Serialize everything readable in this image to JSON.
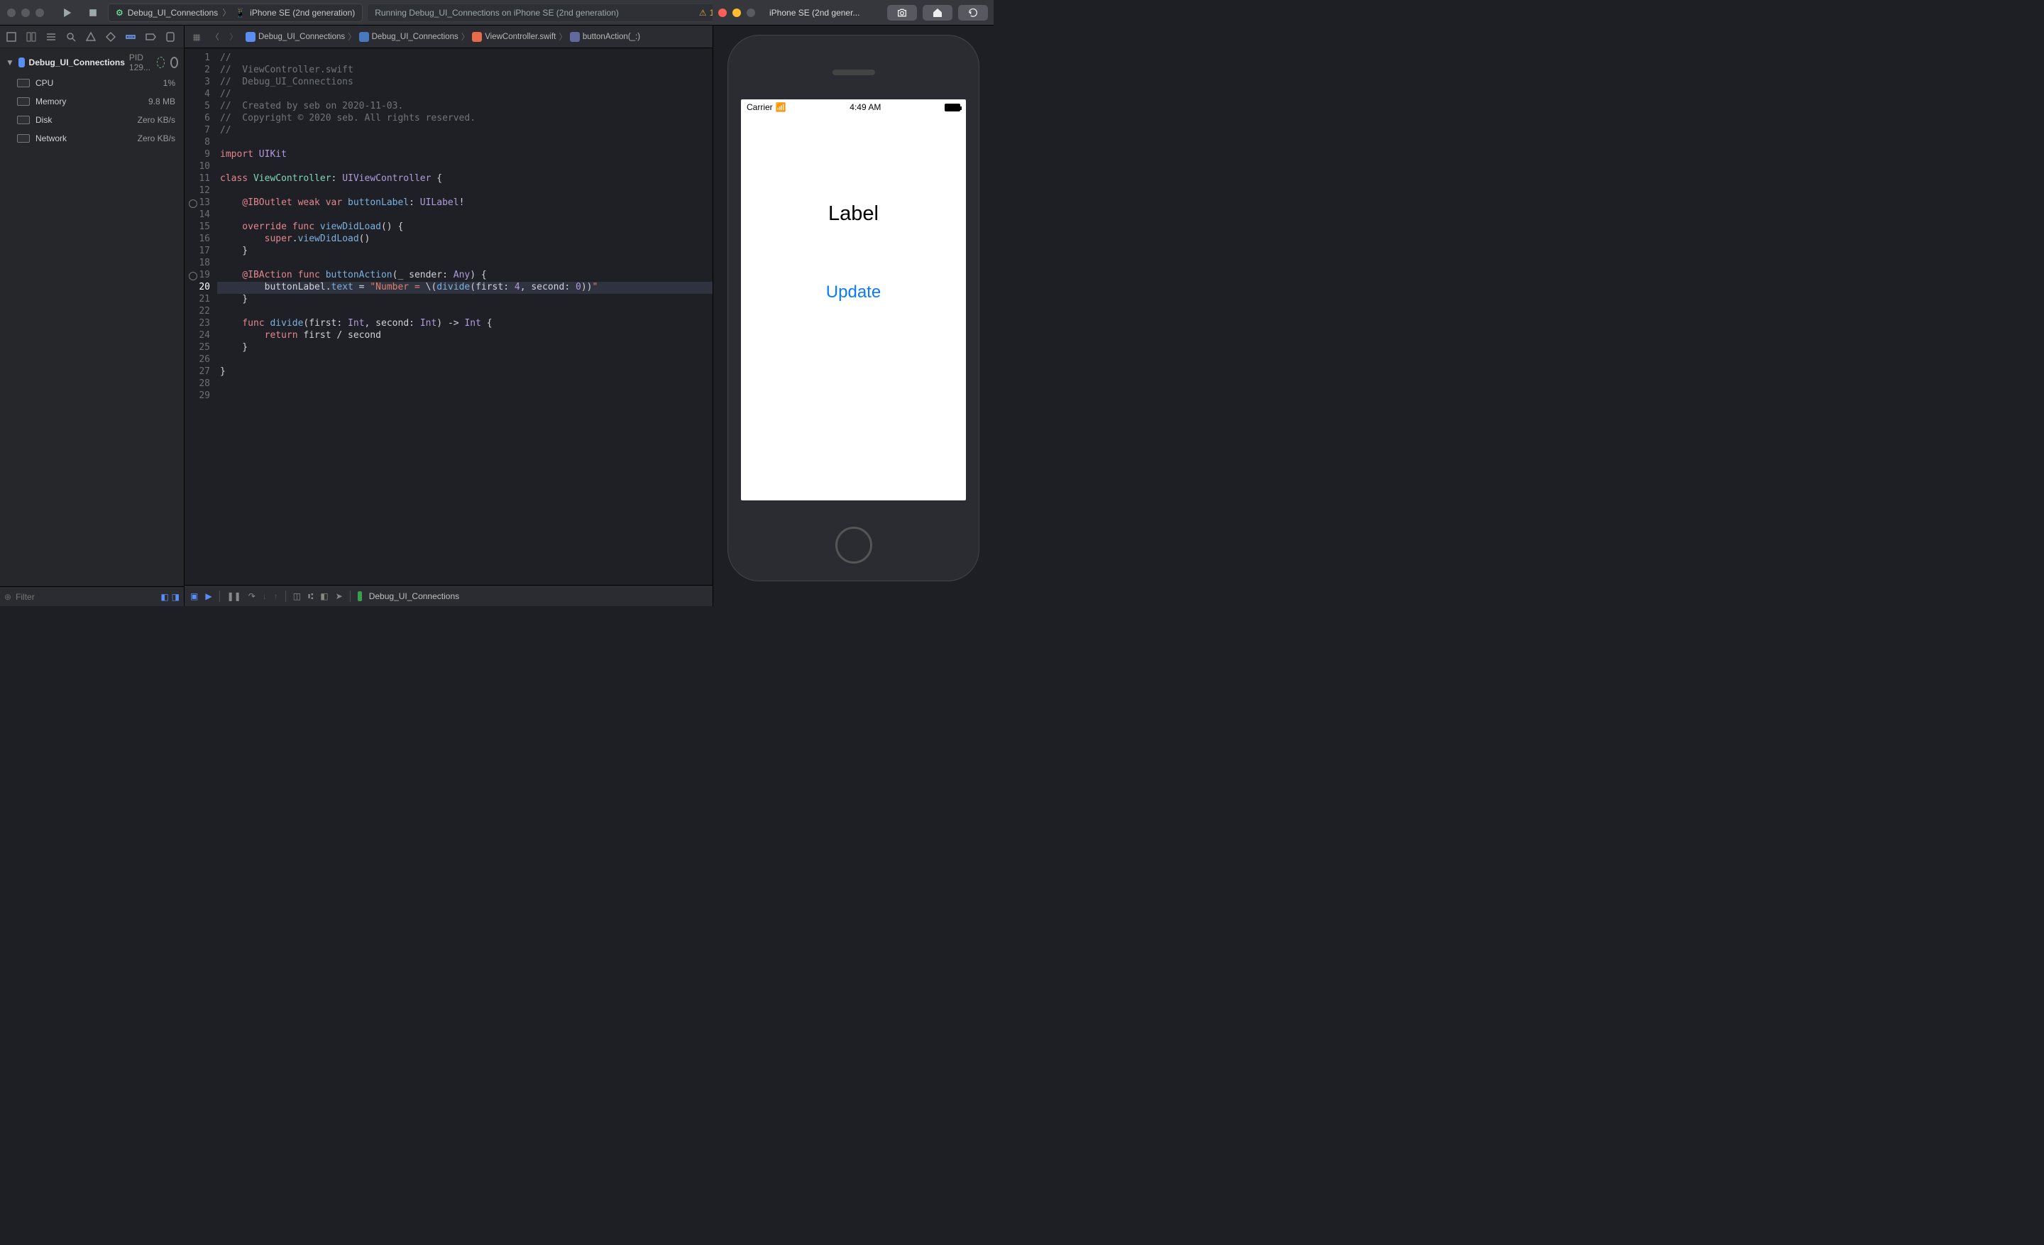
{
  "titlebar": {
    "scheme": "Debug_UI_Connections",
    "device": "iPhone SE (2nd generation)",
    "status": "Running Debug_UI_Connections on iPhone SE (2nd generation)",
    "warn_count": "1"
  },
  "navigator": {
    "root_name": "Debug_UI_Connections",
    "root_pid": "PID 129...",
    "resources": [
      {
        "name": "CPU",
        "val": "1%"
      },
      {
        "name": "Memory",
        "val": "9.8 MB"
      },
      {
        "name": "Disk",
        "val": "Zero KB/s"
      },
      {
        "name": "Network",
        "val": "Zero KB/s"
      }
    ],
    "filter_placeholder": "Filter"
  },
  "editor": {
    "crumbs": [
      {
        "ic": "xcproj",
        "t": "Debug_UI_Connections"
      },
      {
        "ic": "folder",
        "t": "Debug_UI_Connections"
      },
      {
        "ic": "swift",
        "t": "ViewController.swift"
      },
      {
        "ic": "method",
        "t": "buttonAction(_:)"
      }
    ],
    "lines": {
      "l1": "//",
      "l2": "//  ViewController.swift",
      "l3": "//  Debug_UI_Connections",
      "l4": "//",
      "l5": "//  Created by seb on 2020-11-03.",
      "l6": "//  Copyright © 2020 seb. All rights reserved.",
      "l7": "//",
      "l9a": "import",
      "l9b": " UIKit",
      "l11a": "class ",
      "l11b": "ViewController",
      "l11c": ": ",
      "l11d": "UIViewController",
      "l11e": " {",
      "l13a": "    @IBOutlet",
      "l13b": " weak var ",
      "l13c": "buttonLabel",
      "l13d": ": ",
      "l13e": "UILabel",
      "l13f": "!",
      "l15a": "    override func ",
      "l15b": "viewDidLoad",
      "l15c": "() {",
      "l16a": "        super",
      "l16b": ".",
      "l16c": "viewDidLoad",
      "l16d": "()",
      "l17": "    }",
      "l19a": "    @IBAction",
      "l19b": " func ",
      "l19c": "buttonAction",
      "l19d": "(_",
      "l19e": " sender: ",
      "l19f": "Any",
      "l19g": ") {",
      "l20a": "        buttonLabel",
      "l20b": ".",
      "l20c": "text",
      "l20d": " = ",
      "l20e": "\"Number = ",
      "l20f": "\\(",
      "l20g": "divide",
      "l20h": "(first: ",
      "l20i": "4",
      "l20j": ", second: ",
      "l20k": "0",
      "l20l": "))",
      "l20m": "\"",
      "l21": "    }",
      "l23a": "    func ",
      "l23b": "divide",
      "l23c": "(first: ",
      "l23d": "Int",
      "l23e": ", second: ",
      "l23f": "Int",
      "l23g": ") -> ",
      "l23h": "Int",
      "l23i": " {",
      "l24a": "        return",
      "l24b": " first / second",
      "l25": "    }",
      "l27": "}"
    },
    "bottom_target": "Debug_UI_Connections"
  },
  "simulator": {
    "title": "iPhone SE (2nd gener...",
    "status_carrier": "Carrier",
    "status_time": "4:49 AM",
    "label_text": "Label",
    "button_text": "Update"
  }
}
